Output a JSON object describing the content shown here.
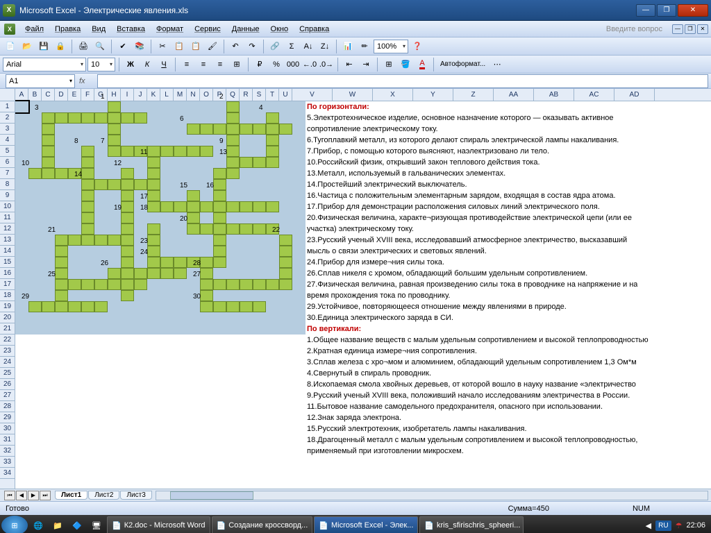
{
  "window": {
    "title": "Microsoft Excel - Электрические явления.xls"
  },
  "menu": [
    "Файл",
    "Правка",
    "Вид",
    "Вставка",
    "Формат",
    "Сервис",
    "Данные",
    "Окно",
    "Справка"
  ],
  "question_placeholder": "Введите вопрос",
  "font": {
    "name": "Arial",
    "size": "10"
  },
  "zoom": "100%",
  "autoformat": "Автоформат...",
  "namebox": "A1",
  "columns_narrow": [
    "A",
    "B",
    "C",
    "D",
    "E",
    "F",
    "G",
    "H",
    "I",
    "J",
    "K",
    "L",
    "M",
    "N",
    "O",
    "P",
    "Q",
    "R",
    "S",
    "T",
    "U"
  ],
  "columns_wide": [
    "V",
    "W",
    "X",
    "Y",
    "Z",
    "AA",
    "AB",
    "AC",
    "AD"
  ],
  "row_count": 34,
  "crossword": {
    "cells": [
      [
        1,
        8
      ],
      [
        1,
        17
      ],
      [
        2,
        3
      ],
      [
        2,
        4
      ],
      [
        2,
        5
      ],
      [
        2,
        6
      ],
      [
        2,
        7
      ],
      [
        2,
        8
      ],
      [
        2,
        9
      ],
      [
        2,
        10
      ],
      [
        2,
        17
      ],
      [
        2,
        20
      ],
      [
        3,
        3
      ],
      [
        3,
        8
      ],
      [
        3,
        14
      ],
      [
        3,
        15
      ],
      [
        3,
        16
      ],
      [
        3,
        17
      ],
      [
        3,
        18
      ],
      [
        3,
        19
      ],
      [
        3,
        20
      ],
      [
        3,
        21
      ],
      [
        4,
        3
      ],
      [
        4,
        8
      ],
      [
        4,
        17
      ],
      [
        4,
        20
      ],
      [
        5,
        3
      ],
      [
        5,
        6
      ],
      [
        5,
        8
      ],
      [
        5,
        9
      ],
      [
        5,
        10
      ],
      [
        5,
        11
      ],
      [
        5,
        12
      ],
      [
        5,
        13
      ],
      [
        5,
        14
      ],
      [
        5,
        15
      ],
      [
        5,
        17
      ],
      [
        5,
        20
      ],
      [
        6,
        3
      ],
      [
        6,
        6
      ],
      [
        6,
        11
      ],
      [
        6,
        17
      ],
      [
        6,
        18
      ],
      [
        6,
        19
      ],
      [
        6,
        20
      ],
      [
        7,
        2
      ],
      [
        7,
        3
      ],
      [
        7,
        4
      ],
      [
        7,
        5
      ],
      [
        7,
        6
      ],
      [
        7,
        9
      ],
      [
        7,
        11
      ],
      [
        7,
        16
      ],
      [
        7,
        17
      ],
      [
        8,
        6
      ],
      [
        8,
        7
      ],
      [
        8,
        8
      ],
      [
        8,
        9
      ],
      [
        8,
        10
      ],
      [
        8,
        11
      ],
      [
        8,
        16
      ],
      [
        9,
        6
      ],
      [
        9,
        9
      ],
      [
        9,
        11
      ],
      [
        9,
        14
      ],
      [
        9,
        16
      ],
      [
        10,
        6
      ],
      [
        10,
        9
      ],
      [
        10,
        11
      ],
      [
        10,
        12
      ],
      [
        10,
        13
      ],
      [
        10,
        14
      ],
      [
        10,
        15
      ],
      [
        10,
        16
      ],
      [
        10,
        17
      ],
      [
        10,
        18
      ],
      [
        10,
        19
      ],
      [
        10,
        20
      ],
      [
        11,
        6
      ],
      [
        11,
        9
      ],
      [
        11,
        14
      ],
      [
        11,
        16
      ],
      [
        12,
        6
      ],
      [
        12,
        9
      ],
      [
        12,
        11
      ],
      [
        12,
        14
      ],
      [
        12,
        15
      ],
      [
        12,
        16
      ],
      [
        12,
        17
      ],
      [
        12,
        18
      ],
      [
        12,
        19
      ],
      [
        12,
        20
      ],
      [
        13,
        4
      ],
      [
        13,
        5
      ],
      [
        13,
        6
      ],
      [
        13,
        7
      ],
      [
        13,
        8
      ],
      [
        13,
        9
      ],
      [
        13,
        11
      ],
      [
        13,
        16
      ],
      [
        13,
        21
      ],
      [
        14,
        4
      ],
      [
        14,
        9
      ],
      [
        14,
        11
      ],
      [
        14,
        16
      ],
      [
        14,
        21
      ],
      [
        15,
        4
      ],
      [
        15,
        9
      ],
      [
        15,
        11
      ],
      [
        15,
        12
      ],
      [
        15,
        13
      ],
      [
        15,
        14
      ],
      [
        15,
        15
      ],
      [
        15,
        16
      ],
      [
        15,
        21
      ],
      [
        16,
        4
      ],
      [
        16,
        8
      ],
      [
        16,
        9
      ],
      [
        16,
        10
      ],
      [
        16,
        11
      ],
      [
        16,
        12
      ],
      [
        16,
        13
      ],
      [
        16,
        15
      ],
      [
        16,
        21
      ],
      [
        17,
        4
      ],
      [
        17,
        5
      ],
      [
        17,
        6
      ],
      [
        17,
        7
      ],
      [
        17,
        8
      ],
      [
        17,
        9
      ],
      [
        17,
        10
      ],
      [
        17,
        15
      ],
      [
        17,
        16
      ],
      [
        17,
        17
      ],
      [
        17,
        18
      ],
      [
        17,
        19
      ],
      [
        17,
        20
      ],
      [
        17,
        21
      ],
      [
        18,
        4
      ],
      [
        18,
        9
      ],
      [
        18,
        15
      ],
      [
        19,
        2
      ],
      [
        19,
        3
      ],
      [
        19,
        4
      ],
      [
        19,
        5
      ],
      [
        19,
        6
      ],
      [
        19,
        7
      ],
      [
        19,
        15
      ],
      [
        19,
        16
      ],
      [
        19,
        17
      ],
      [
        19,
        18
      ],
      [
        19,
        19
      ]
    ],
    "numbers": [
      {
        "r": 1,
        "c": 8,
        "n": "1"
      },
      {
        "r": 1,
        "c": 17,
        "n": "2"
      },
      {
        "r": 2,
        "c": 3,
        "n": "3"
      },
      {
        "r": 2,
        "c": 20,
        "n": "4"
      },
      {
        "r": 3,
        "c": 14,
        "n": "6"
      },
      {
        "r": 5,
        "c": 6,
        "n": "8"
      },
      {
        "r": 5,
        "c": 8,
        "n": "7"
      },
      {
        "r": 5,
        "c": 17,
        "n": "9"
      },
      {
        "r": 6,
        "c": 11,
        "n": "11"
      },
      {
        "r": 6,
        "c": 17,
        "n": "13"
      },
      {
        "r": 7,
        "c": 2,
        "n": "10"
      },
      {
        "r": 7,
        "c": 9,
        "n": "12"
      },
      {
        "r": 8,
        "c": 6,
        "n": "14"
      },
      {
        "r": 9,
        "c": 14,
        "n": "15"
      },
      {
        "r": 9,
        "c": 16,
        "n": "16"
      },
      {
        "r": 10,
        "c": 11,
        "n": "17"
      },
      {
        "r": 11,
        "c": 9,
        "n": "19"
      },
      {
        "r": 11,
        "c": 11,
        "n": "18"
      },
      {
        "r": 12,
        "c": 14,
        "n": "20"
      },
      {
        "r": 13,
        "c": 4,
        "n": "21"
      },
      {
        "r": 13,
        "c": 21,
        "n": "22"
      },
      {
        "r": 14,
        "c": 11,
        "n": "23"
      },
      {
        "r": 15,
        "c": 11,
        "n": "24"
      },
      {
        "r": 16,
        "c": 8,
        "n": "26"
      },
      {
        "r": 16,
        "c": 15,
        "n": "28"
      },
      {
        "r": 17,
        "c": 4,
        "n": "25"
      },
      {
        "r": 17,
        "c": 15,
        "n": "27"
      },
      {
        "r": 19,
        "c": 2,
        "n": "29"
      },
      {
        "r": 19,
        "c": 15,
        "n": "30"
      }
    ]
  },
  "clues": {
    "h_title": "По горизонтали:",
    "v_title": "По вертикали:",
    "lines": [
      "5.Электротехническое изделие, основное назначение которого — оказывать активное",
      "сопротивление электрическому току.",
      "6.Тугоплавкий металл, из которого делают спираль электрической лампы накаливания.",
      "7.Прибор, с помощью которого выясняют, наэлектризовано ли тело.",
      "10.Российский физик, открывший закон теплового действия тока.",
      "13.Металл, используемый в гальванических элементах.",
      "14.Простейший электрический выключатель.",
      "16.Частица с положительным элементарным зарядом, входящая в состав ядра атома.",
      "17.Прибор для демонстрации расположения силовых линий электрического поля.",
      "20.Физическая величина, характе¬ризующая противодействие электрической цепи (или ее",
      "участка) электрическому току.",
      "23.Русский ученый XVIII века, исследовавший атмосферное электричество, высказавший",
      "мысль о связи электрических и световых явлений.",
      "24.Прибор для измере¬ния силы тока.",
      "26.Сплав никеля с хромом, обладающий большим удельным сопротивлением.",
      "27.Физическая величина, равная произведению силы тока в проводнике на напряжение и на",
      "время прохождения тока по проводнику.",
      "29.Устойчивое, повторяющееся отношение между явлениями в природе.",
      "30.Единица электрического заряда в СИ."
    ],
    "vlines": [
      "1.Общее название веществ с малым удельным сопротивлением и высокой теплопроводностью",
      "2.Кратная единица измере¬ния сопротивления.",
      "3.Сплав железа с хро¬мом и алюминием, обладающий удельным сопротивлением 1,3 Ом*м",
      "4.Свернутый в спираль проводник.",
      "8.Ископаемая смола хвойных деревьев, от которой вошло в науку название «электричество",
      "9.Русский ученый XVIII века, положивший начало исследованиям электричества в России.",
      "11.Бытовое название самодельного предохранителя, опасного при использовании.",
      "12.Знак заряда электрона.",
      "15.Русский электротехник, изобретатель лампы накаливания.",
      "18.Драгоценный металл с малым удельным сопротивлением и высокой теплопроводностью,",
      "применяемый при изготовлении микросхем."
    ]
  },
  "tabs": [
    "Лист1",
    "Лист2",
    "Лист3"
  ],
  "status": {
    "ready": "Готово",
    "sum": "Сумма=450",
    "num": "NUM"
  },
  "taskbar": {
    "items": [
      {
        "label": "К2.doc - Microsoft Word"
      },
      {
        "label": "Создание кроссворд..."
      },
      {
        "label": "Microsoft Excel - Элек...",
        "active": true
      },
      {
        "label": "kris_sfirischris_spheeri..."
      }
    ],
    "lang": "RU",
    "time": "22:06"
  }
}
